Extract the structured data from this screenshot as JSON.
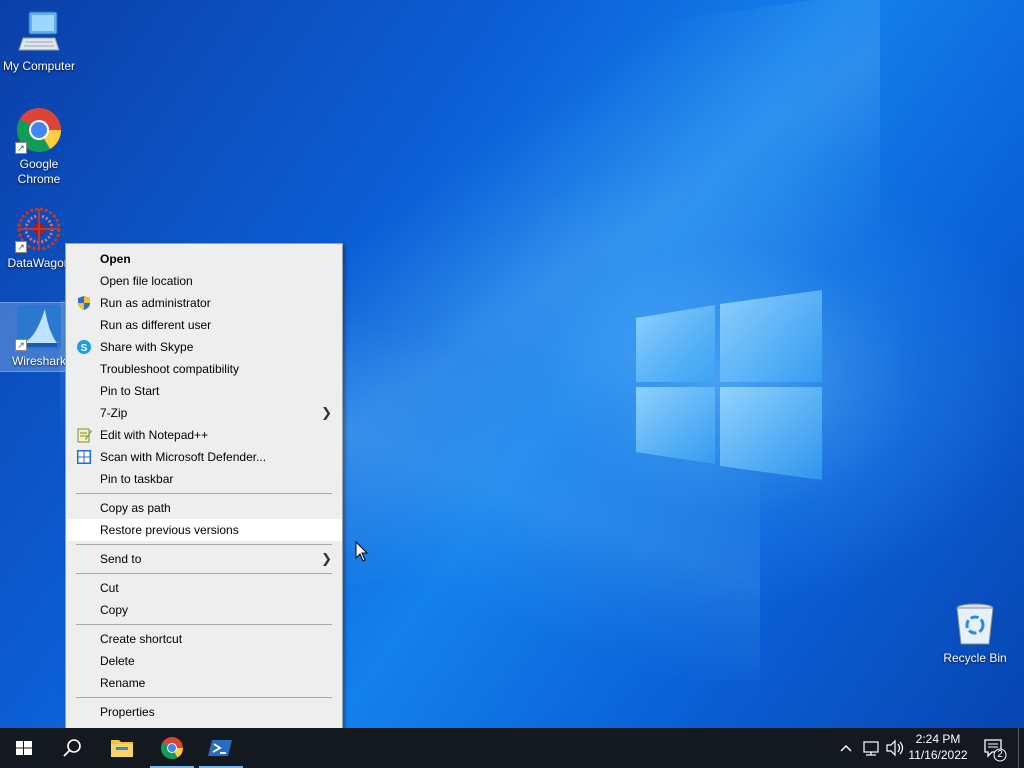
{
  "desktop": {
    "icons": [
      {
        "label": "My Computer",
        "icon": "computer-icon"
      },
      {
        "label": "Google Chrome",
        "icon": "chrome-icon"
      },
      {
        "label": "DataWagon",
        "icon": "datawagon-icon"
      },
      {
        "label": "Wireshark",
        "icon": "wireshark-icon"
      },
      {
        "label": "Recycle Bin",
        "icon": "recycle-bin-icon"
      }
    ]
  },
  "context_menu": {
    "items": [
      {
        "label": "Open",
        "bold": true
      },
      {
        "label": "Open file location"
      },
      {
        "label": "Run as administrator",
        "icon": "uac-shield-icon"
      },
      {
        "label": "Run as different user"
      },
      {
        "label": "Share with Skype",
        "icon": "skype-icon"
      },
      {
        "label": "Troubleshoot compatibility"
      },
      {
        "label": "Pin to Start"
      },
      {
        "label": "7-Zip",
        "submenu": true
      },
      {
        "label": "Edit with Notepad++",
        "icon": "notepadpp-icon"
      },
      {
        "label": "Scan with Microsoft Defender...",
        "icon": "defender-icon"
      },
      {
        "label": "Pin to taskbar"
      },
      {
        "label": "Copy as path"
      },
      {
        "label": "Restore previous versions",
        "hovered": true
      },
      {
        "label": "Send to",
        "submenu": true
      },
      {
        "label": "Cut"
      },
      {
        "label": "Copy"
      },
      {
        "label": "Create shortcut"
      },
      {
        "label": "Delete"
      },
      {
        "label": "Rename"
      },
      {
        "label": "Properties"
      }
    ]
  },
  "taskbar": {
    "buttons": [
      {
        "name": "start-button",
        "icon": "windows-start-icon"
      },
      {
        "name": "search-button",
        "icon": "search-icon"
      },
      {
        "name": "file-explorer-button",
        "icon": "folder-icon"
      },
      {
        "name": "chrome-taskbar-button",
        "icon": "chrome-icon"
      },
      {
        "name": "powershell-taskbar-button",
        "icon": "powershell-icon"
      }
    ],
    "tray": {
      "time": "2:24 PM",
      "date": "11/16/2022",
      "notification_count": "2"
    }
  },
  "colors": {
    "taskbar": "#14181f",
    "menu_bg": "#eeeeee",
    "menu_hover": "#ffffff",
    "accent": "#76b9ed"
  }
}
